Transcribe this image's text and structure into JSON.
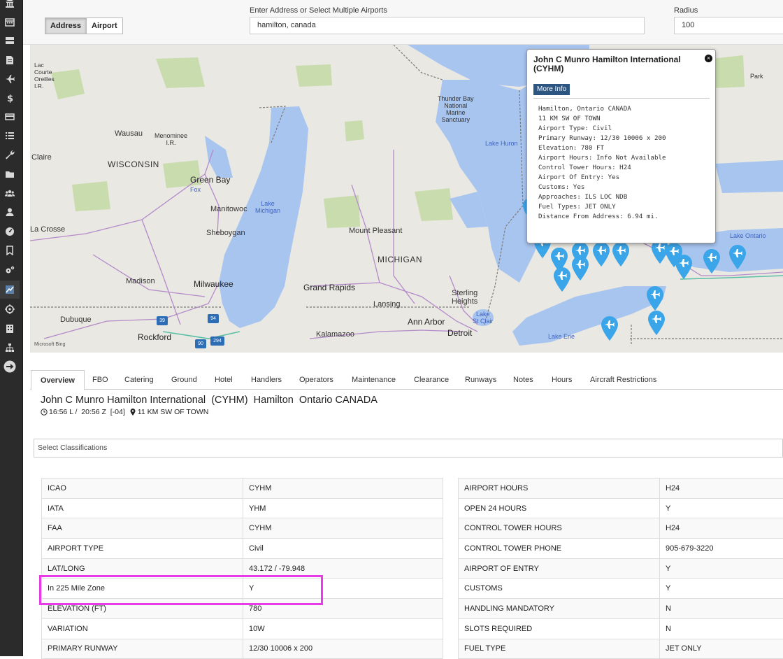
{
  "rail": {
    "icons": [
      "bank-icon",
      "calendar-icon",
      "server-icon",
      "document-icon",
      "plane-icon",
      "dollar-icon",
      "card-icon",
      "list-icon",
      "wrench-icon",
      "folder-icon",
      "group-icon",
      "user-icon",
      "gauge-icon",
      "bookmark-icon",
      "settings-icon",
      "chart-icon",
      "target-icon",
      "building-icon",
      "org-icon",
      "arrow-right-icon"
    ]
  },
  "search": {
    "mode_address": "Address",
    "mode_airport": "Airport",
    "address_label": "Enter Address or Select Multiple Airports",
    "address_value": "hamilton, canada",
    "radius_label": "Radius",
    "radius_value": "100"
  },
  "map": {
    "labels": {
      "lac_courte": "Lac\nCourte\nOreilles\nI.R.",
      "wausau": "Wausau",
      "menominee": "Menominee\nI.R.",
      "claire": "Claire",
      "wisconsin": "WISCONSIN",
      "green_bay": "Green Bay",
      "fox": "Fox",
      "manitowoc": "Manitowoc",
      "sheboygan": "Sheboygan",
      "la_crosse": "La Crosse",
      "madison": "Madison",
      "milwaukee": "Milwaukee",
      "dubuque": "Dubuque",
      "rockford": "Rockford",
      "lake_michigan": "Lake\nMichigan",
      "thunder_bay": "Thunder Bay\nNational\nMarine\nSanctuary",
      "lake_huron": "Lake Huron",
      "mount_pleasant": "Mount Pleasant",
      "michigan": "MICHIGAN",
      "grand_rapids": "Grand Rapids",
      "lansing": "Lansing",
      "sterling_heights": "Sterling\nHeights",
      "lake_st_clair": "Lake\nSt Clair",
      "ann_arbor": "Ann Arbor",
      "detroit": "Detroit",
      "kalamazoo": "Kalamazoo",
      "lake_erie": "Lake Erie",
      "lake_ontario": "Lake Ontario",
      "park": "Park",
      "bing": "Microsoft Bing",
      "shield_39": "39",
      "shield_94": "94",
      "shield_90": "90",
      "shield_294": "294"
    }
  },
  "popup": {
    "title": "John C Munro Hamilton International (CYHM)",
    "close_label": "×",
    "more_info_label": "More Info",
    "lines": [
      "Hamilton, Ontario CANADA",
      "11 KM SW OF TOWN",
      "Airport Type: Civil",
      "Primary Runway: 12/30 10006 x 200",
      "Elevation: 780 FT",
      "Airport Hours: Info Not Available",
      "Control Tower Hours: H24",
      "Airport Of Entry: Yes",
      "Customs: Yes",
      "Approaches: ILS LOC NDB",
      "Fuel Types: JET ONLY",
      "Distance From Address: 6.94 mi."
    ]
  },
  "tabs": [
    "Overview",
    "FBO",
    "Catering",
    "Ground",
    "Hotel",
    "Handlers",
    "Operators",
    "Maintenance",
    "Clearance",
    "Runways",
    "Notes",
    "Hours",
    "Aircraft Restrictions"
  ],
  "airport": {
    "title": "John C Munro Hamilton International  (CYHM)  Hamilton  Ontario CANADA",
    "time": "16:56 L /  20:56 Z  [-04]",
    "location": "11 KM SW OF TOWN",
    "classification_placeholder": "Select Classifications"
  },
  "left_table": [
    {
      "k": "ICAO",
      "v": "CYHM"
    },
    {
      "k": "IATA",
      "v": "YHM"
    },
    {
      "k": "FAA",
      "v": "CYHM"
    },
    {
      "k": "AIRPORT TYPE",
      "v": "Civil"
    },
    {
      "k": "LAT/LONG",
      "v": "43.172 / -79.948"
    },
    {
      "k": "In 225 Mile Zone",
      "v": "Y"
    },
    {
      "k": "ELEVATION (FT)",
      "v": "780"
    },
    {
      "k": "VARIATION",
      "v": "10W"
    },
    {
      "k": "PRIMARY RUNWAY",
      "v": "12/30 10006 x 200"
    }
  ],
  "right_table": [
    {
      "k": "AIRPORT HOURS",
      "v": "H24"
    },
    {
      "k": "OPEN 24 HOURS",
      "v": "Y"
    },
    {
      "k": "CONTROL TOWER HOURS",
      "v": "H24"
    },
    {
      "k": "CONTROL TOWER PHONE",
      "v": "905-679-3220"
    },
    {
      "k": "AIRPORT OF ENTRY",
      "v": "Y"
    },
    {
      "k": "CUSTOMS",
      "v": "Y"
    },
    {
      "k": "HANDLING MANDATORY",
      "v": "N"
    },
    {
      "k": "SLOTS REQUIRED",
      "v": "N"
    },
    {
      "k": "FUEL TYPE",
      "v": "JET ONLY"
    }
  ],
  "colors": {
    "highlight": "#e83ae6",
    "pin": "#3aa5e8",
    "water": "#a8c5f0",
    "land": "#e9e8e2",
    "rail_bg": "#2b2b2b"
  }
}
